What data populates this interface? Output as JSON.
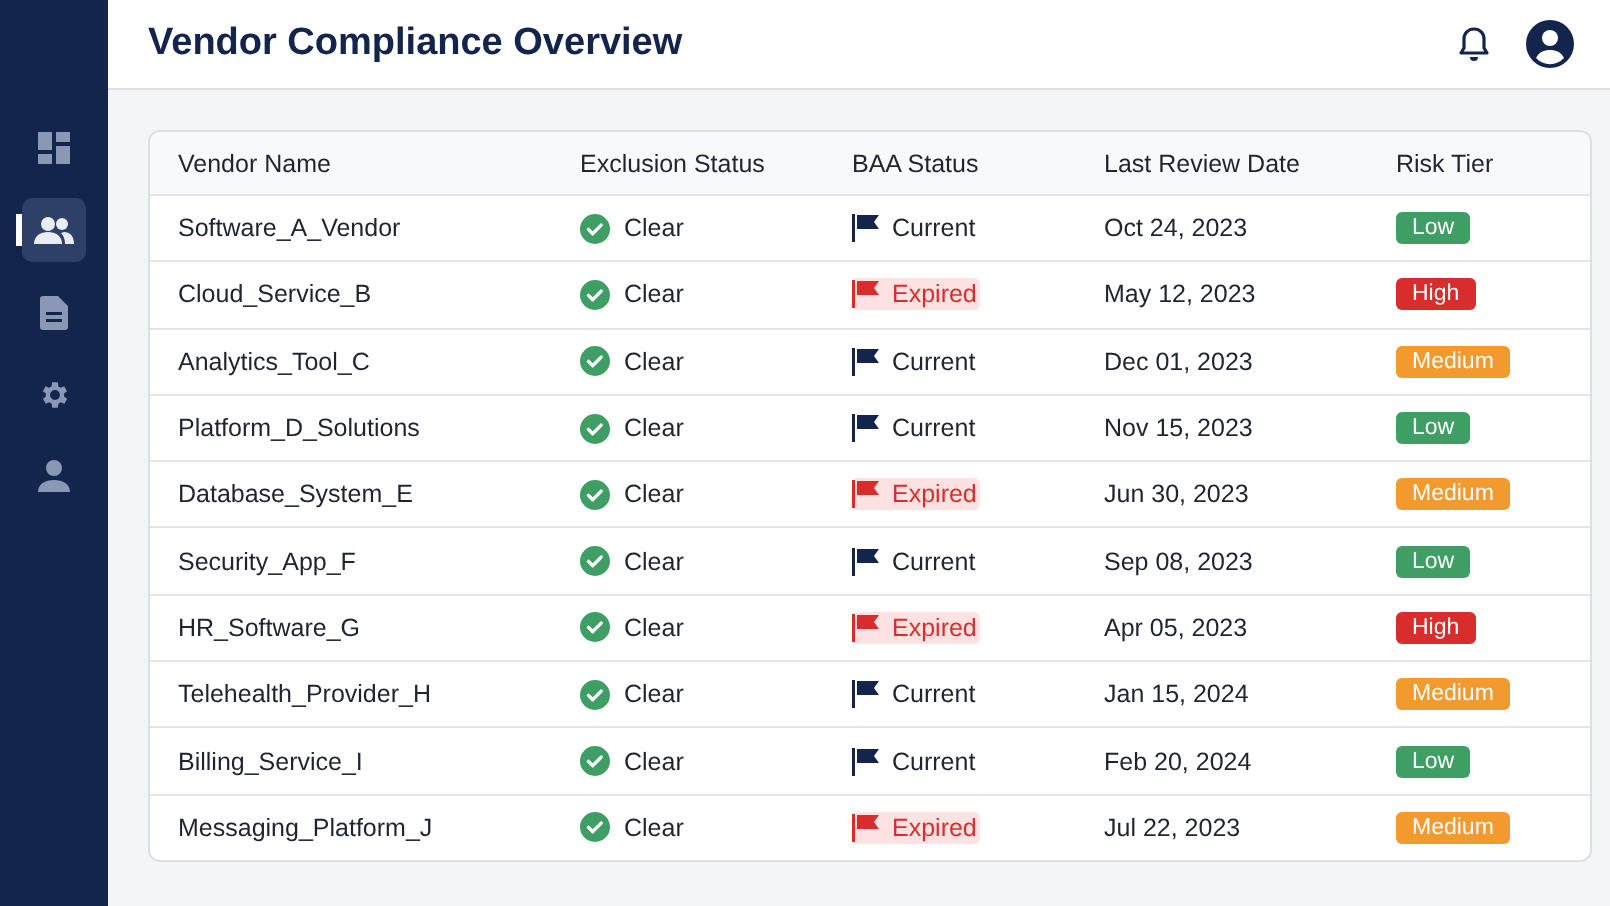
{
  "sidebar": {
    "items": [
      {
        "kind": "dashboard",
        "selected": false
      },
      {
        "kind": "people",
        "selected": true
      },
      {
        "kind": "document",
        "selected": false
      },
      {
        "kind": "settings",
        "selected": false
      },
      {
        "kind": "person",
        "selected": false
      }
    ]
  },
  "header": {
    "title": "Vendor Compliance Overview"
  },
  "table": {
    "columns": [
      "Vendor Name",
      "Exclusion Status",
      "BAA Status",
      "Last Review Date",
      "Risk Tier"
    ],
    "rows": [
      {
        "vendor": "Software_A_Vendor",
        "exclusion": {
          "kind": "clear",
          "label": "Clear"
        },
        "baa": {
          "kind": "current",
          "label": "Current"
        },
        "date": "Oct 24, 2023",
        "risk": {
          "kind": "low",
          "label": "Low"
        }
      },
      {
        "vendor": "Cloud_Service_B",
        "exclusion": {
          "kind": "clear",
          "label": "Clear"
        },
        "baa": {
          "kind": "expired",
          "label": "Expired"
        },
        "date": "May 12, 2023",
        "risk": {
          "kind": "high",
          "label": "High"
        }
      },
      {
        "vendor": "Analytics_Tool_C",
        "exclusion": {
          "kind": "clear",
          "label": "Clear"
        },
        "baa": {
          "kind": "current",
          "label": "Current"
        },
        "date": "Dec 01, 2023",
        "risk": {
          "kind": "medium",
          "label": "Medium"
        }
      },
      {
        "vendor": "Platform_D_Solutions",
        "exclusion": {
          "kind": "clear",
          "label": "Clear"
        },
        "baa": {
          "kind": "current",
          "label": "Current"
        },
        "date": "Nov 15, 2023",
        "risk": {
          "kind": "low",
          "label": "Low"
        }
      },
      {
        "vendor": "Database_System_E",
        "exclusion": {
          "kind": "clear",
          "label": "Clear"
        },
        "baa": {
          "kind": "expired",
          "label": "Expired"
        },
        "date": "Jun 30, 2023",
        "risk": {
          "kind": "medium",
          "label": "Medium"
        }
      },
      {
        "vendor": "Security_App_F",
        "exclusion": {
          "kind": "clear",
          "label": "Clear"
        },
        "baa": {
          "kind": "current",
          "label": "Current"
        },
        "date": "Sep 08, 2023",
        "risk": {
          "kind": "low",
          "label": "Low"
        }
      },
      {
        "vendor": "HR_Software_G",
        "exclusion": {
          "kind": "clear",
          "label": "Clear"
        },
        "baa": {
          "kind": "expired",
          "label": "Expired"
        },
        "date": "Apr 05, 2023",
        "risk": {
          "kind": "high",
          "label": "High"
        }
      },
      {
        "vendor": "Telehealth_Provider_H",
        "exclusion": {
          "kind": "clear",
          "label": "Clear"
        },
        "baa": {
          "kind": "current",
          "label": "Current"
        },
        "date": "Jan 15, 2024",
        "risk": {
          "kind": "medium",
          "label": "Medium"
        }
      },
      {
        "vendor": "Billing_Service_I",
        "exclusion": {
          "kind": "clear",
          "label": "Clear"
        },
        "baa": {
          "kind": "current",
          "label": "Current"
        },
        "date": "Feb 20, 2024",
        "risk": {
          "kind": "low",
          "label": "Low"
        }
      },
      {
        "vendor": "Messaging_Platform_J",
        "exclusion": {
          "kind": "clear",
          "label": "Clear"
        },
        "baa": {
          "kind": "expired",
          "label": "Expired"
        },
        "date": "Jul 22, 2023",
        "risk": {
          "kind": "medium",
          "label": "Medium"
        }
      }
    ]
  }
}
